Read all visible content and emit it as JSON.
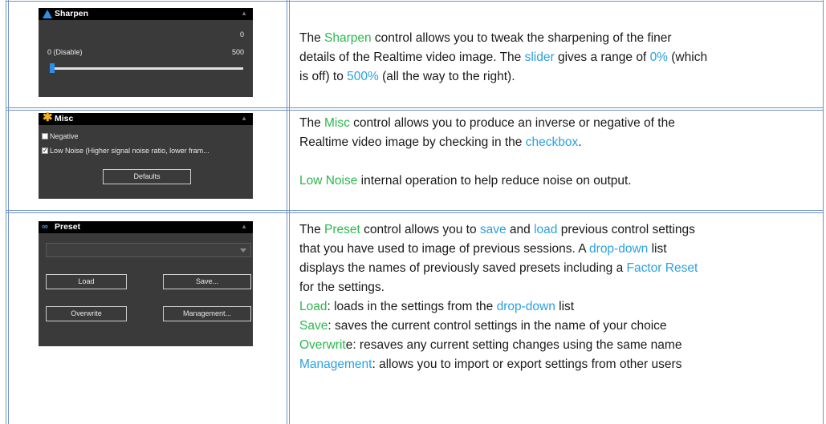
{
  "rows": [
    {
      "panel": {
        "title": "Sharpen",
        "value": "0",
        "min_label": "0 (Disable)",
        "max_label": "500",
        "slider_fraction": 0.0
      },
      "lines": [
        [
          {
            "t": "The "
          },
          {
            "t": "Sharpen",
            "c": "g"
          },
          {
            "t": " control allows you to tweak the sharpening of the finer"
          }
        ],
        [
          {
            "t": "details of the Realtime video image. The "
          },
          {
            "t": "slider",
            "c": "b"
          },
          {
            "t": " gives a range of "
          },
          {
            "t": "0%",
            "c": "b"
          },
          {
            "t": " (which"
          }
        ],
        [
          {
            "t": "is off) to "
          },
          {
            "t": "500%",
            "c": "b"
          },
          {
            "t": " (all the way to the right)."
          }
        ]
      ]
    },
    {
      "panel": {
        "title": "Misc",
        "checkbox1": "Negative",
        "checkbox2": "Low Noise (Higher signal noise ratio, lower fram...",
        "defaults_button": "Defaults"
      },
      "lines": [
        [
          {
            "t": "The "
          },
          {
            "t": "Misc",
            "c": "g"
          },
          {
            "t": " control allows you to produce an inverse or negative of the"
          }
        ],
        [
          {
            "t": "Realtime video image by checking in the "
          },
          {
            "t": "checkbox",
            "c": "b"
          },
          {
            "t": "."
          }
        ],
        [
          {
            "t": ""
          }
        ],
        [
          {
            "t": "Low Noise",
            "c": "g"
          },
          {
            "t": " internal operation to help reduce noise on output."
          }
        ]
      ]
    },
    {
      "panel": {
        "title": "Preset",
        "load_button": "Load",
        "save_button": "Save...",
        "overwrite_button": "Overwrite",
        "management_button": "Management..."
      },
      "lines": [
        [
          {
            "t": "The "
          },
          {
            "t": "Preset",
            "c": "g"
          },
          {
            "t": " control allows you to "
          },
          {
            "t": "save",
            "c": "b"
          },
          {
            "t": " and "
          },
          {
            "t": "load",
            "c": "b"
          },
          {
            "t": " previous control settings"
          }
        ],
        [
          {
            "t": "that you have used to image of previous sessions. A "
          },
          {
            "t": "drop-down",
            "c": "b"
          },
          {
            "t": " list"
          }
        ],
        [
          {
            "t": "displays the names of previously saved presets including a "
          },
          {
            "t": "Factor Reset",
            "c": "b"
          }
        ],
        [
          {
            "t": "for the settings."
          }
        ],
        [
          {
            "t": "Load",
            "c": "g"
          },
          {
            "t": ": loads in the settings from the "
          },
          {
            "t": "drop-down",
            "c": "b"
          },
          {
            "t": " list"
          }
        ],
        [
          {
            "t": "Save",
            "c": "g"
          },
          {
            "t": ": saves the current control settings in the name of your choice"
          }
        ],
        [
          {
            "t": "Overwrit",
            "c": "g"
          },
          {
            "t": "e: resaves any current setting changes using the same name"
          }
        ],
        [
          {
            "t": "Management",
            "c": "b"
          },
          {
            "t": ": allows you to import or export settings from other users"
          }
        ]
      ]
    }
  ],
  "colors": {
    "highlight_green": "#2bb84d",
    "highlight_blue": "#2aa0e0",
    "border": "#6f93c4",
    "panel_bg": "#3a3a3a"
  }
}
